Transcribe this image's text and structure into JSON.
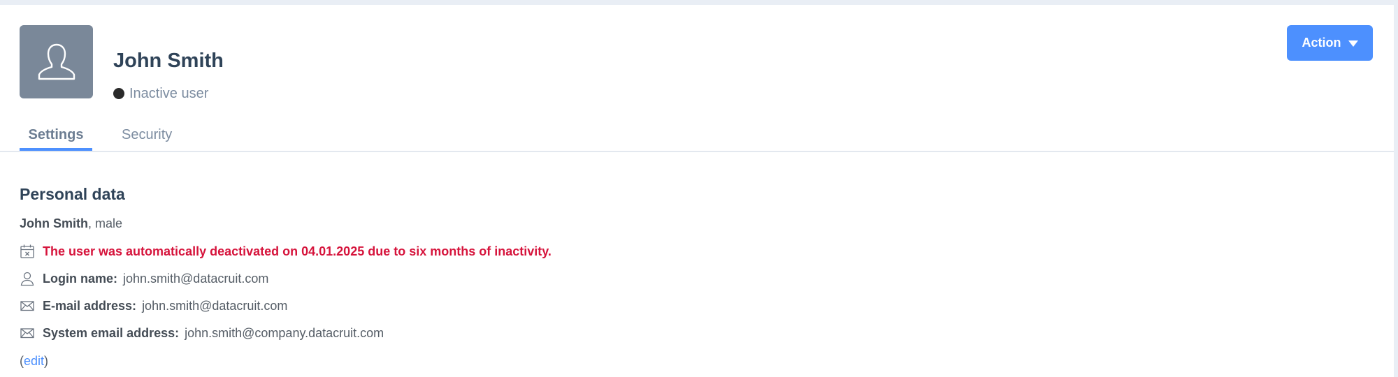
{
  "profile": {
    "name": "John Smith",
    "status": "Inactive user",
    "avatar_icon": "user-silhouette-icon"
  },
  "header": {
    "action_label": "Action"
  },
  "tabs": [
    {
      "label": "Settings",
      "active": true
    },
    {
      "label": "Security",
      "active": false
    }
  ],
  "personal_data": {
    "title": "Personal data",
    "full_name": "John Smith",
    "gender_suffix": ", male",
    "warning": "The user was automatically deactivated on 04.01.2025 due to six months of inactivity.",
    "login_label": "Login name:",
    "login_value": "john.smith@datacruit.com",
    "email_label": "E-mail address:",
    "email_value": "john.smith@datacruit.com",
    "system_email_label": "System email address:",
    "system_email_value": "john.smith@company.datacruit.com",
    "edit_open": "(",
    "edit_label": "edit",
    "edit_close": ")"
  },
  "colors": {
    "accent": "#4d90fe",
    "warning": "#d6143c",
    "title": "#2f4358",
    "avatar_bg": "#7a8899"
  }
}
